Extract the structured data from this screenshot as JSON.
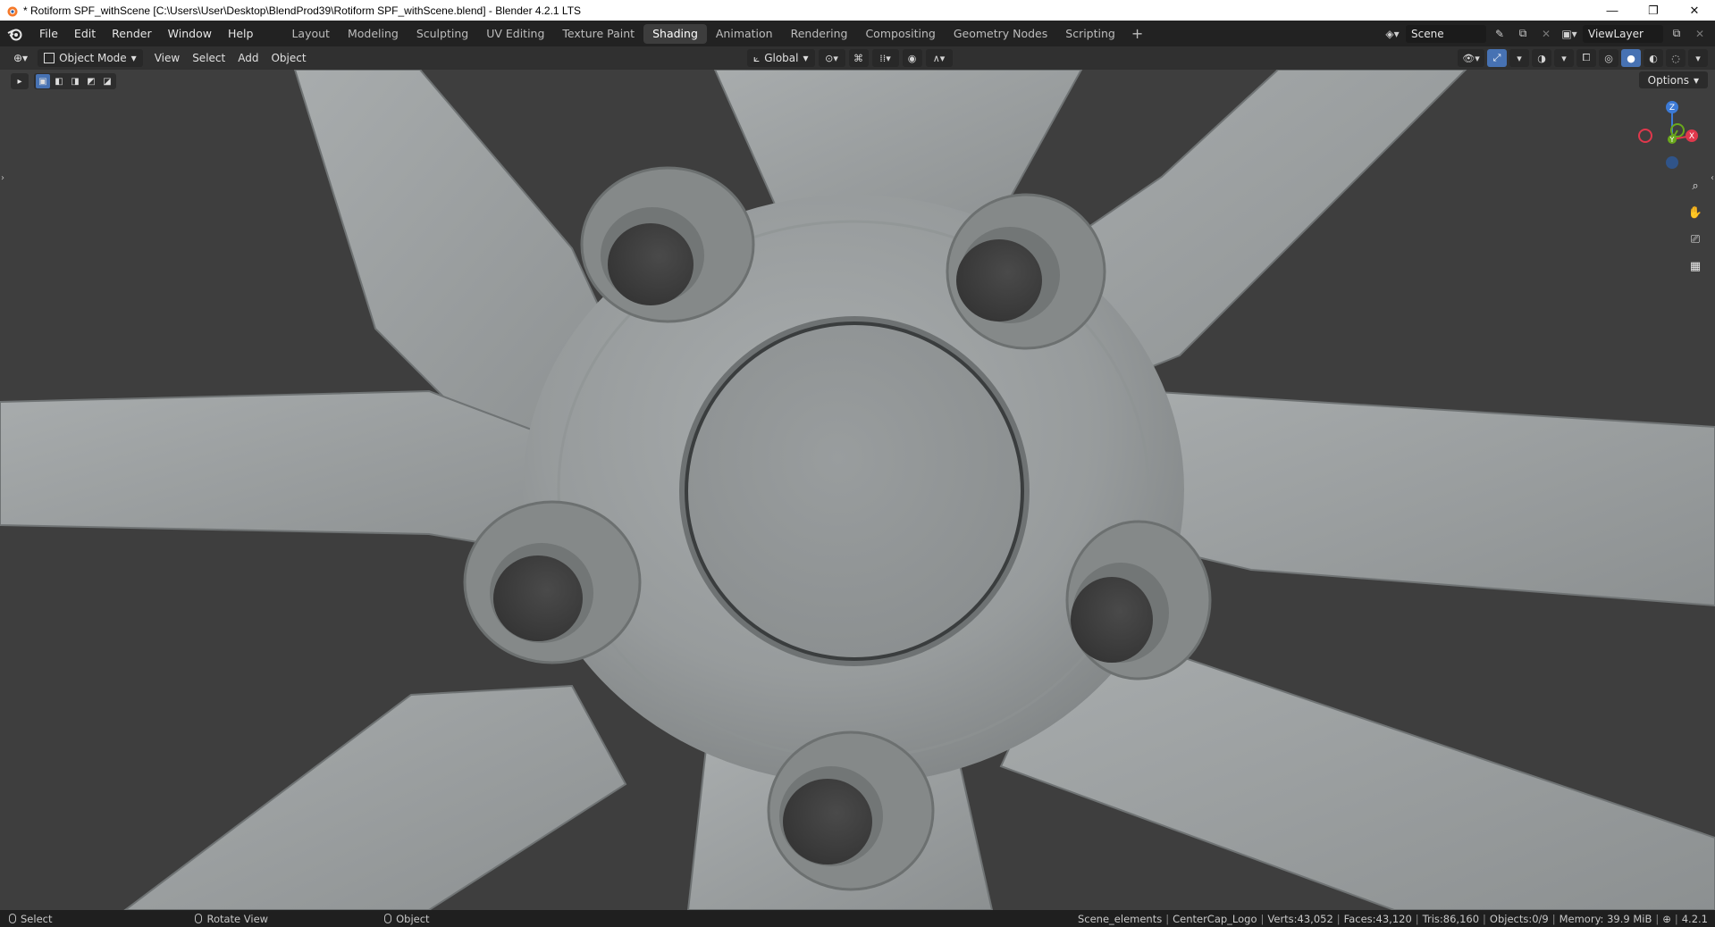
{
  "window": {
    "title": "* Rotiform SPF_withScene [C:\\Users\\User\\Desktop\\BlendProd39\\Rotiform SPF_withScene.blend] - Blender 4.2.1 LTS",
    "controls": [
      "—",
      "❐",
      "✕"
    ]
  },
  "menu": [
    "File",
    "Edit",
    "Render",
    "Window",
    "Help"
  ],
  "workspaces": [
    {
      "label": "Layout",
      "active": false
    },
    {
      "label": "Modeling",
      "active": false
    },
    {
      "label": "Sculpting",
      "active": false
    },
    {
      "label": "UV Editing",
      "active": false
    },
    {
      "label": "Texture Paint",
      "active": false
    },
    {
      "label": "Shading",
      "active": true
    },
    {
      "label": "Animation",
      "active": false
    },
    {
      "label": "Rendering",
      "active": false
    },
    {
      "label": "Compositing",
      "active": false
    },
    {
      "label": "Geometry Nodes",
      "active": false
    },
    {
      "label": "Scripting",
      "active": false
    }
  ],
  "workspace_add": "+",
  "scene": {
    "name": "Scene"
  },
  "view_layer": {
    "name": "ViewLayer"
  },
  "viewport_header": {
    "mode": "Object Mode",
    "menus": [
      "View",
      "Select",
      "Add",
      "Object"
    ],
    "transform_orientation": "Global"
  },
  "viewport": {
    "options_label": "Options",
    "gizmo": {
      "x": "X",
      "y": "Y",
      "z": "Z"
    },
    "colors": {
      "x_axis": "#e0384c",
      "y_axis": "#6aa81c",
      "z_axis": "#3c7ad6"
    }
  },
  "statusbar": {
    "hints": [
      {
        "label": "Select"
      },
      {
        "label": "Rotate View"
      },
      {
        "label": "Object"
      }
    ],
    "collection": "Scene_elements",
    "active_object": "CenterCap_Logo",
    "verts": "Verts:43,052",
    "faces": "Faces:43,120",
    "tris": "Tris:86,160",
    "objects": "Objects:0/9",
    "memory": "Memory: 39.9 MiB",
    "version": "4.2.1"
  }
}
